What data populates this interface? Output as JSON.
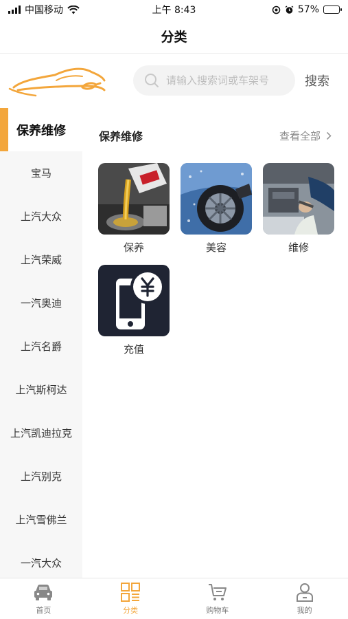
{
  "status": {
    "carrier": "中国移动",
    "time": "上午 8:43",
    "battery": "57%",
    "battery_level": 0.57
  },
  "header": {
    "title": "分类"
  },
  "search": {
    "placeholder": "请输入搜索词或车架号",
    "button": "搜索"
  },
  "sidebar": {
    "items": [
      {
        "label": "保养维修",
        "active": true
      },
      {
        "label": "宝马"
      },
      {
        "label": "上汽大众"
      },
      {
        "label": "上汽荣威"
      },
      {
        "label": "一汽奥迪"
      },
      {
        "label": "上汽名爵"
      },
      {
        "label": "上汽斯柯达"
      },
      {
        "label": "上汽凯迪拉克"
      },
      {
        "label": "上汽别克"
      },
      {
        "label": "上汽雪佛兰"
      },
      {
        "label": "一汽大众"
      }
    ]
  },
  "main": {
    "section_title": "保养维修",
    "view_all": "查看全部",
    "categories": [
      {
        "label": "保养",
        "icon": "oil-pour-image"
      },
      {
        "label": "美容",
        "icon": "car-wash-image"
      },
      {
        "label": "维修",
        "icon": "engine-repair-image"
      },
      {
        "label": "充值",
        "icon": "phone-recharge-icon"
      }
    ]
  },
  "tabbar": {
    "tabs": [
      {
        "label": "首页",
        "icon": "car-icon"
      },
      {
        "label": "分类",
        "icon": "category-grid-icon",
        "active": true
      },
      {
        "label": "购物车",
        "icon": "cart-icon"
      },
      {
        "label": "我的",
        "icon": "user-icon"
      }
    ]
  },
  "colors": {
    "accent": "#f3a63b",
    "recharge_bg": "#1f2433"
  }
}
